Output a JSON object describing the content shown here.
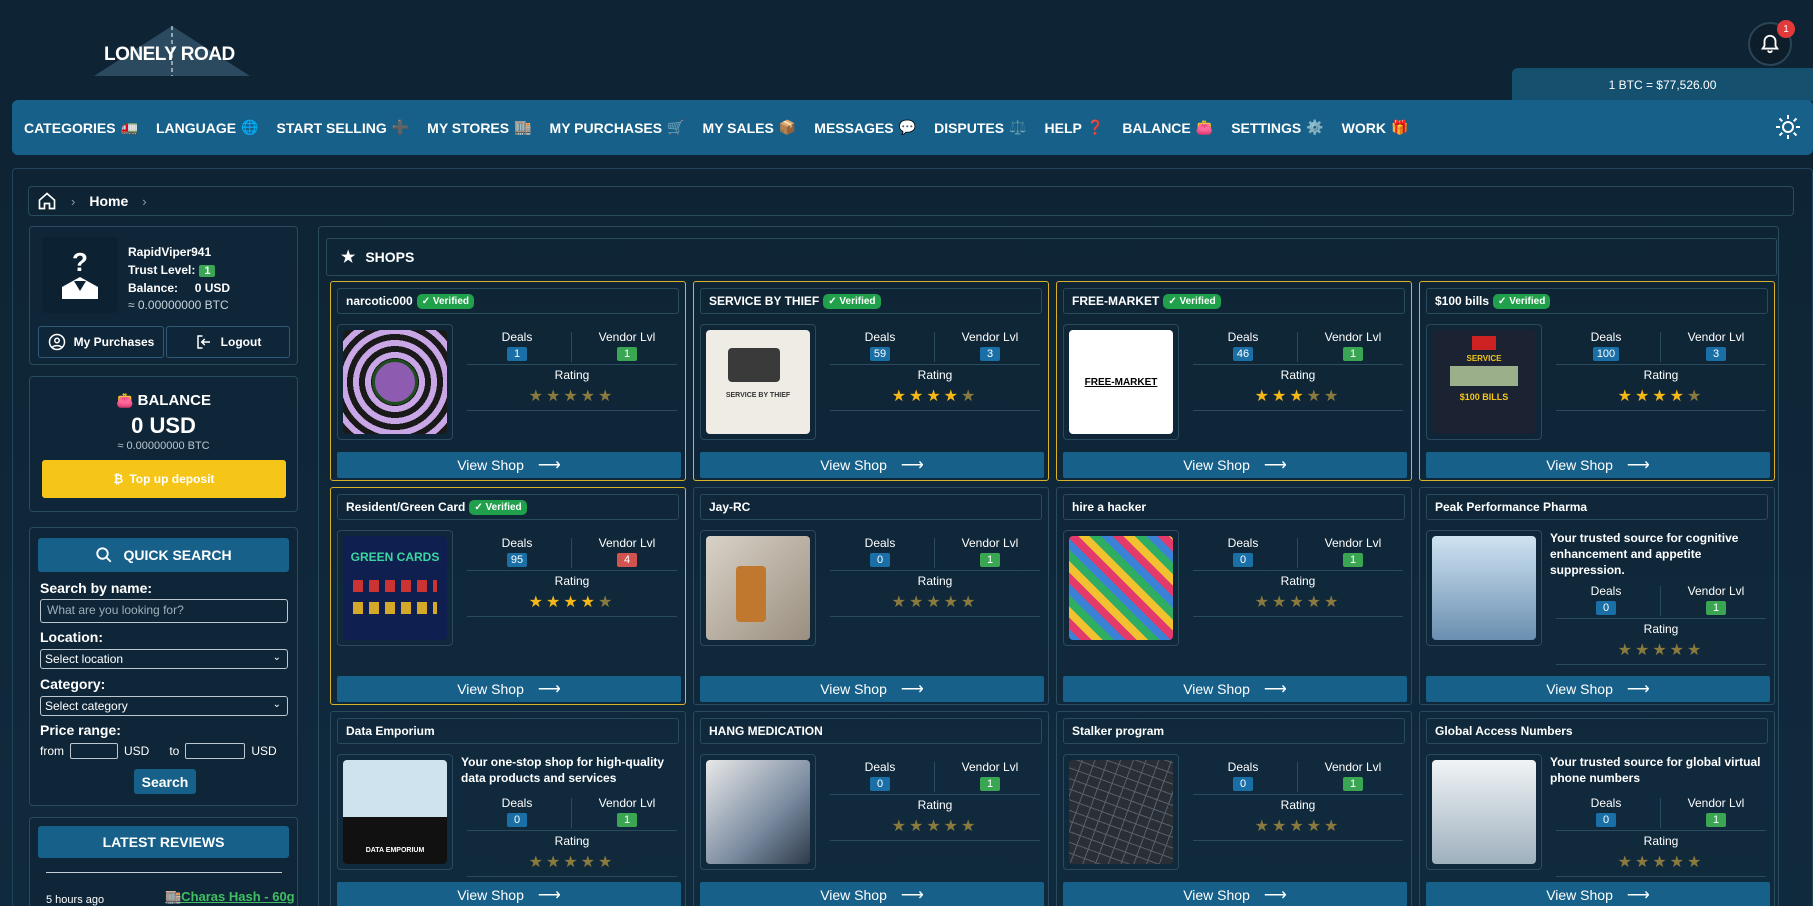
{
  "logo": {
    "text": "LONELY ROAD"
  },
  "notifications": {
    "count": "1"
  },
  "btc_rate": "1 BTC = $77,526.00",
  "nav": [
    {
      "label": "CATEGORIES",
      "emoji": "🚛"
    },
    {
      "label": "LANGUAGE",
      "emoji": "🌐"
    },
    {
      "label": "START SELLING",
      "emoji": "➕"
    },
    {
      "label": "MY STORES",
      "emoji": "🏬"
    },
    {
      "label": "MY PURCHASES",
      "emoji": "🛒"
    },
    {
      "label": "MY SALES",
      "emoji": "📦"
    },
    {
      "label": "MESSAGES",
      "emoji": "💬"
    },
    {
      "label": "DISPUTES",
      "emoji": "⚖️"
    },
    {
      "label": "HELP",
      "emoji": "❓"
    },
    {
      "label": "BALANCE",
      "emoji": "👛"
    },
    {
      "label": "SETTINGS",
      "emoji": "⚙️"
    },
    {
      "label": "WORK",
      "emoji": "🎁"
    }
  ],
  "breadcrumb": {
    "home": "Home"
  },
  "profile": {
    "username": "RapidViper941",
    "trust_label": "Trust Level:",
    "trust_value": "1",
    "balance_line": "Balance:     0 USD",
    "btc_line": "≈ 0.00000000 BTC",
    "purchases_btn": "My Purchases",
    "logout_btn": "Logout"
  },
  "balance": {
    "title": "BALANCE",
    "usd": "0 USD",
    "btc": "≈ 0.00000000 BTC",
    "topup": "Top up deposit"
  },
  "search": {
    "title": "QUICK SEARCH",
    "name_label": "Search by name:",
    "name_placeholder": "What are you looking for?",
    "location_label": "Location:",
    "location_value": "Select location",
    "category_label": "Category:",
    "category_value": "Select category",
    "price_label": "Price range:",
    "from": "from",
    "to": "to",
    "usd1": "USD",
    "usd2": "USD",
    "button": "Search"
  },
  "reviews": {
    "title": "LATEST REVIEWS",
    "time": "5 hours ago",
    "link": "🏬Charas Hash - 60g"
  },
  "shops_title": "SHOPS",
  "labels": {
    "deals": "Deals",
    "vendor": "Vendor Lvl",
    "rating": "Rating",
    "view": "View Shop",
    "verified": "✓ Verified"
  },
  "shops": [
    {
      "name": "narcotic000",
      "verified": true,
      "deals": "1",
      "vendor": "1",
      "vendor_color": "green",
      "rating": 0
    },
    {
      "name": "SERVICE BY THIEF",
      "verified": true,
      "deals": "59",
      "vendor": "3",
      "vendor_color": "blue",
      "rating": 4.5
    },
    {
      "name": "FREE-MARKET",
      "verified": true,
      "deals": "46",
      "vendor": "1",
      "vendor_color": "green",
      "rating": 3.5
    },
    {
      "name": "$100 bills",
      "verified": true,
      "deals": "100",
      "vendor": "3",
      "vendor_color": "blue",
      "rating": 4
    },
    {
      "name": "Resident/Green Card",
      "verified": true,
      "deals": "95",
      "vendor": "4",
      "vendor_color": "red",
      "rating": 4.5
    },
    {
      "name": "Jay-RC",
      "verified": false,
      "deals": "0",
      "vendor": "1",
      "vendor_color": "green",
      "rating": 0
    },
    {
      "name": "hire a hacker",
      "verified": false,
      "deals": "0",
      "vendor": "1",
      "vendor_color": "green",
      "rating": 0
    },
    {
      "name": "Peak Performance Pharma",
      "verified": false,
      "deals": "0",
      "vendor": "1",
      "vendor_color": "green",
      "rating": 0,
      "desc": "Your trusted source for cognitive enhancement and appetite suppression."
    },
    {
      "name": "Data Emporium",
      "verified": false,
      "deals": "0",
      "vendor": "1",
      "vendor_color": "green",
      "rating": 0,
      "desc": "Your one-stop shop for high-quality data products and services"
    },
    {
      "name": "HANG MEDICATION",
      "verified": false,
      "deals": "0",
      "vendor": "1",
      "vendor_color": "green",
      "rating": 0
    },
    {
      "name": "Stalker program",
      "verified": false,
      "deals": "0",
      "vendor": "1",
      "vendor_color": "green",
      "rating": 0
    },
    {
      "name": "Global Access Numbers",
      "verified": false,
      "deals": "0",
      "vendor": "1",
      "vendor_color": "green",
      "rating": 0,
      "desc": "Your trusted source for global virtual phone numbers"
    }
  ],
  "shop_images": {
    "s1": "",
    "s2": "SERVICE BY THIEF",
    "s3": "FREE-MARKET",
    "s4a": "SERVICE",
    "s4b": "$100 BILLS",
    "s5": "GREEN CARDS",
    "s9": "DATA EMPORIUM"
  }
}
